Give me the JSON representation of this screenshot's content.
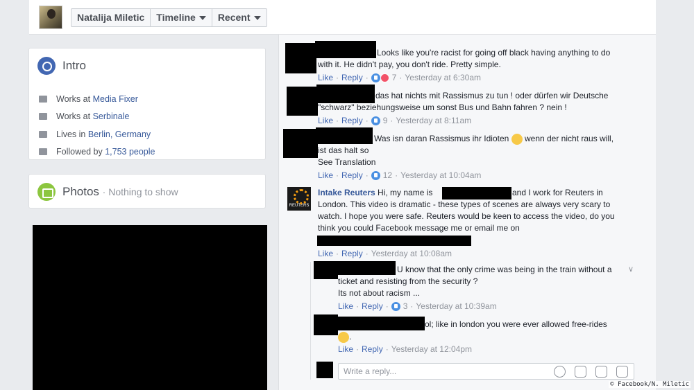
{
  "header": {
    "profile_name": "Natalija Miletic",
    "timeline_label": "Timeline",
    "recent_label": "Recent"
  },
  "intro": {
    "title": "Intro",
    "items": [
      {
        "prefix": "Works at ",
        "link": "Media Fixer",
        "icon": "briefcase-icon"
      },
      {
        "prefix": "Works at ",
        "link": "Serbinale",
        "icon": "briefcase-icon"
      },
      {
        "prefix": "Lives in ",
        "link": "Berlin, Germany",
        "icon": "home-icon"
      },
      {
        "prefix": "Followed by ",
        "link": "1,753 people",
        "icon": "rss-icon"
      }
    ]
  },
  "photos": {
    "title": "Photos",
    "subtitle": "· Nothing to show"
  },
  "comments": [
    {
      "text_line1": "Looks like you're racist for going off black having anything to do",
      "text_line2": "with it. He didn't pay, you don't ride. Pretty simple.",
      "reactions": "7",
      "time": "Yesterday at 6:30am"
    },
    {
      "text_line1": "das hat nichts mit Rassismus zu tun ! oder dürfen wir Deutsche",
      "text_line2": "\"schwarz\" beziehungsweise um sonst Bus und Bahn fahren ? nein !",
      "reactions": "9",
      "time": "Yesterday at 8:11am"
    },
    {
      "text_line1": "Was isn daran Rassismus ihr Idioten",
      "text_line1b": "wenn der nicht raus will,",
      "text_line2": "ist das halt so",
      "see_translation": "See Translation",
      "reactions": "12",
      "time": "Yesterday at 10:04am"
    },
    {
      "author": "Intake Reuters",
      "logo_text": "REUTERS",
      "text_line1a": "Hi, my name is",
      "text_line1b": "and I work for Reuters in",
      "text_line2": "London. This video is dramatic - these types of scenes are always very scary to",
      "text_line3": "watch. I hope you were safe. Reuters would be keen to access the video, do you",
      "text_line4": "think you could Facebook message me or email me on",
      "time": "Yesterday at 10:08am"
    }
  ],
  "replies": [
    {
      "text_line1": "U know that the only crime was being in the train without a",
      "text_line2": "ticket and resisting from the security ?",
      "text_line3": "Its not about racism ...",
      "reactions": "3",
      "time": "Yesterday at 10:39am"
    },
    {
      "text_line1": "ol; like in london you were ever allowed free-rides",
      "text_line2": ".",
      "time": "Yesterday at 12:04pm"
    }
  ],
  "actions": {
    "like": "Like",
    "reply": "Reply",
    "sep": "·"
  },
  "reply_box": {
    "placeholder": "Write a reply..."
  },
  "credit": "© Facebook/N. Miletic",
  "colors": {
    "link": "#365899",
    "accent": "#4267b2",
    "page_bg": "#e9ebee"
  }
}
